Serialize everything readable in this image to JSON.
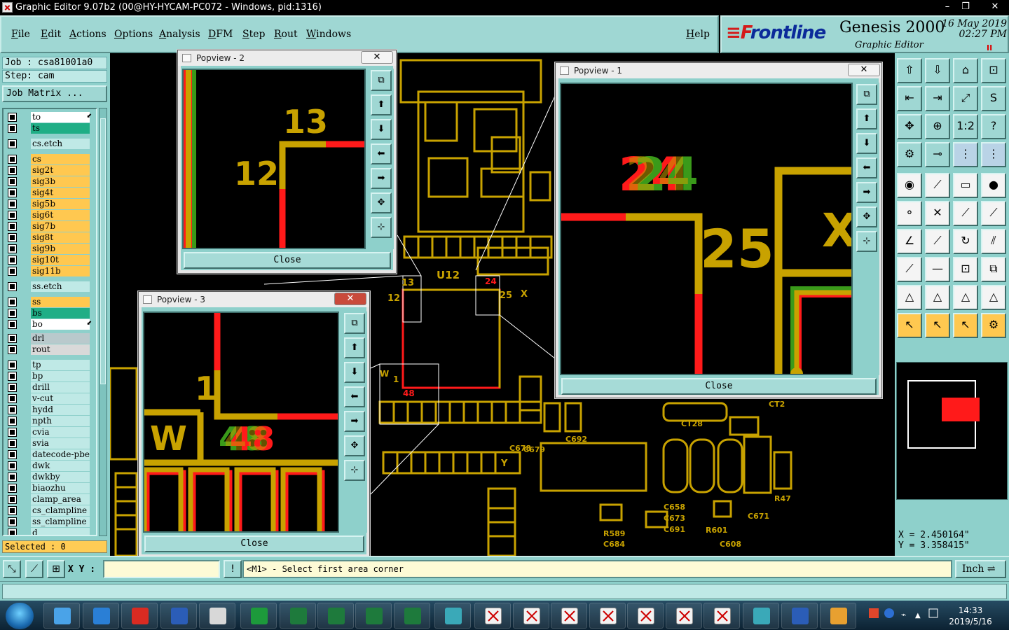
{
  "window": {
    "title": "Graphic Editor 9.07b2 (00@HY-HYCAM-PC072 - Windows, pid:1316)",
    "min": "–",
    "max": "❐",
    "close": "✕"
  },
  "menu": {
    "items": [
      "File",
      "Edit",
      "Actions",
      "Options",
      "Analysis",
      "DFM",
      "Step",
      "Rout",
      "Windows"
    ],
    "help": "Help"
  },
  "brand": {
    "logo_f": "≡F",
    "logo_rest": "rontline",
    "product": "Genesis 2000",
    "date": "16 May 2019",
    "time": "02:27 PM",
    "subtitle": "Graphic Editor",
    "pause": "II"
  },
  "job": {
    "job_label": "Job : csa81001a0",
    "step_label": "Step: cam",
    "matrix_label": "Job Matrix ..."
  },
  "layers": [
    {
      "name": "to",
      "color": "#ffffff",
      "arrow": true
    },
    {
      "name": "ts",
      "color": "#1fae86"
    },
    {
      "name": "cs.etch",
      "color": "#bfe9e6"
    },
    {
      "name": "cs",
      "color": "#ffc850"
    },
    {
      "name": "sig2t",
      "color": "#ffc850"
    },
    {
      "name": "sig3b",
      "color": "#ffc850"
    },
    {
      "name": "sig4t",
      "color": "#ffc850"
    },
    {
      "name": "sig5b",
      "color": "#ffc850"
    },
    {
      "name": "sig6t",
      "color": "#ffc850"
    },
    {
      "name": "sig7b",
      "color": "#ffc850"
    },
    {
      "name": "sig8t",
      "color": "#ffc850"
    },
    {
      "name": "sig9b",
      "color": "#ffc850"
    },
    {
      "name": "sig10t",
      "color": "#ffc850"
    },
    {
      "name": "sig11b",
      "color": "#ffc850"
    },
    {
      "name": "ss.etch",
      "color": "#bfe9e6"
    },
    {
      "name": "ss",
      "color": "#ffc850"
    },
    {
      "name": "bs",
      "color": "#1fae86"
    },
    {
      "name": "bo",
      "color": "#ffffff",
      "arrow": true
    },
    {
      "name": "drl",
      "color": "#b9c9cc"
    },
    {
      "name": "rout",
      "color": "#d9d9d9"
    },
    {
      "name": "tp",
      "color": "#bfe9e6"
    },
    {
      "name": "bp",
      "color": "#bfe9e6"
    },
    {
      "name": "drill",
      "color": "#bfe9e6"
    },
    {
      "name": "v-cut",
      "color": "#bfe9e6"
    },
    {
      "name": "hydd",
      "color": "#bfe9e6"
    },
    {
      "name": "npth",
      "color": "#bfe9e6"
    },
    {
      "name": "cvia",
      "color": "#bfe9e6"
    },
    {
      "name": "svia",
      "color": "#bfe9e6"
    },
    {
      "name": "datecode-pbe",
      "color": "#bfe9e6"
    },
    {
      "name": "dwk",
      "color": "#bfe9e6"
    },
    {
      "name": "dwkby",
      "color": "#bfe9e6"
    },
    {
      "name": "biaozhu",
      "color": "#bfe9e6"
    },
    {
      "name": "clamp_area",
      "color": "#bfe9e6"
    },
    {
      "name": "cs_clampline",
      "color": "#bfe9e6"
    },
    {
      "name": "ss_clampline",
      "color": "#bfe9e6"
    },
    {
      "name": "d",
      "color": "#bfe9e6"
    }
  ],
  "selected": "Selected : 0",
  "popups": [
    {
      "title": "Popview - 2",
      "close": "Close"
    },
    {
      "title": "Popview - 1",
      "close": "Close"
    },
    {
      "title": "Popview - 3",
      "close": "Close"
    }
  ],
  "coords": {
    "x": "X = 2.450164\"",
    "y": "Y = 3.358415\""
  },
  "status": {
    "xy_label": "X Y :",
    "xy_value": "",
    "prompt": "<M1> - Select first area corner",
    "unit": "Inch ⇌",
    "alert": "!"
  },
  "clock": {
    "time": "14:33",
    "date": "2019/5/16"
  },
  "canvas_labels": [
    "U12",
    "13",
    "12",
    "24",
    "25",
    "1",
    "48",
    "W",
    "X",
    "Y",
    "C679",
    "R47",
    "CT28",
    "C692",
    "C678",
    "R589",
    "C684",
    "R601",
    "C608",
    "C671",
    "C658",
    "C673",
    "C691",
    "CT2"
  ],
  "colors": {
    "copper": "#c8a200",
    "red": "#ff1a1a",
    "green": "#3a9a1a",
    "panel": "#8ed0cb",
    "button": "#9fd7d3"
  }
}
